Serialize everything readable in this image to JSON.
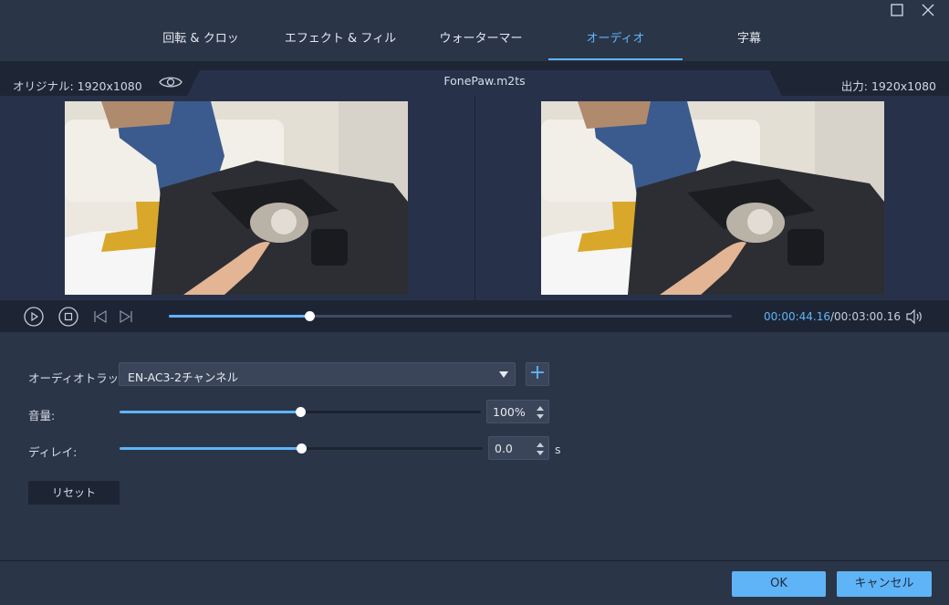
{
  "tabs": [
    {
      "label": "回転 & クロップ"
    },
    {
      "label": "エフェクト & フィルター"
    },
    {
      "label": "ウォーターマーク"
    },
    {
      "label": "オーディオ",
      "active": true
    },
    {
      "label": "字幕"
    }
  ],
  "preview": {
    "original_label": "オリジナル: 1920x1080",
    "file_name": "FonePaw.m2ts",
    "output_label": "出力: 1920x1080"
  },
  "playback": {
    "current_time": "00:00:44.16",
    "total_time": "/00:03:00.16",
    "progress": 0.25
  },
  "audio": {
    "track_label": "オーディオトラック:",
    "track_value": "EN-AC3-2チャンネル",
    "add_symbol": "+",
    "volume_label": "音量:",
    "volume_value": "100%",
    "volume_level": 0.5,
    "delay_label": "ディレイ:",
    "delay_value": "0.0",
    "delay_unit": "s",
    "delay_level": 0.5,
    "reset_label": "リセット"
  },
  "footer": {
    "ok_label": "OK",
    "cancel_label": "キャンセル"
  },
  "colors": {
    "accent": "#5fb4f7",
    "background": "#2b3548",
    "panel_dark": "#1d2534"
  },
  "icons": [
    "maximize-icon",
    "close-icon",
    "eye-icon",
    "play-icon",
    "stop-icon",
    "previous-frame-icon",
    "next-frame-icon",
    "volume-icon"
  ]
}
